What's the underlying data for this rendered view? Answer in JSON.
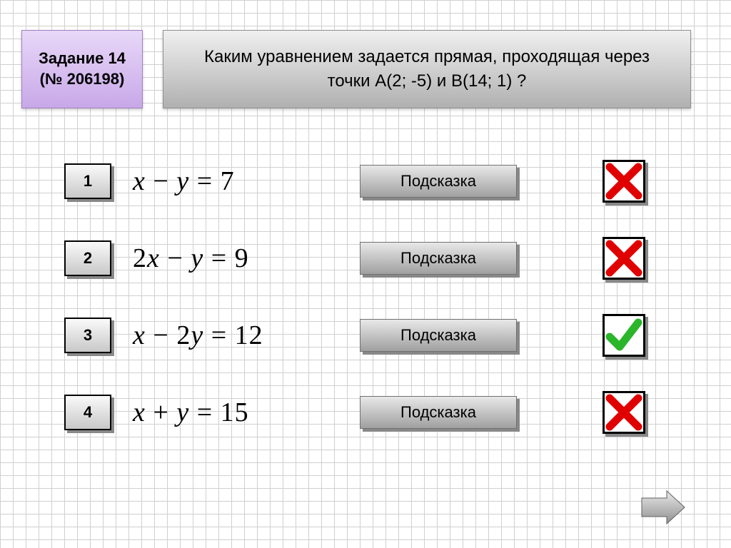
{
  "task": {
    "label_line1": "Задание 14",
    "label_line2": "(№ 206198)"
  },
  "question": "Каким уравнением задается прямая, проходящая через точки А(2; -5) и В(14; 1) ?",
  "hint_label": "Подсказка",
  "options": [
    {
      "num": "1",
      "lhs_a": "x",
      "op1": " − ",
      "lhs_b": "y",
      "rhs": "7",
      "correct": false
    },
    {
      "num": "2",
      "lhs_a": "2x",
      "op1": " − ",
      "lhs_b": "y",
      "rhs": "9",
      "correct": false
    },
    {
      "num": "3",
      "lhs_a": "x",
      "op1": " − ",
      "lhs_b": "2y",
      "rhs": "12",
      "correct": true
    },
    {
      "num": "4",
      "lhs_a": "x",
      "op1": " + ",
      "lhs_b": "y",
      "rhs": "15",
      "correct": false
    }
  ],
  "colors": {
    "accent_purple": "#c8a8e8",
    "correct": "#2bb52b",
    "wrong": "#e00000"
  }
}
